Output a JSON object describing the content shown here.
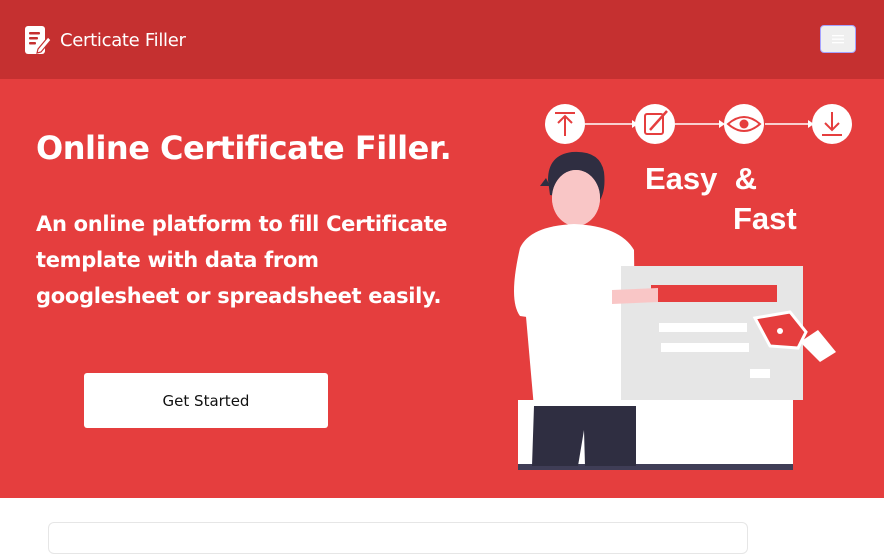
{
  "navbar": {
    "brand_label": "Certicate Filler",
    "brand_icon": "document-pen-icon",
    "toggler_icon": "hamburger-menu-icon"
  },
  "hero": {
    "title": "Online Certificate Filler.",
    "subtitle": "An online platform to fill Certificate template with data from googlesheet or spreadsheet easily.",
    "cta_label": "Get Started"
  },
  "illustration": {
    "steps": [
      "upload-icon",
      "edit-icon",
      "eye-icon",
      "download-icon"
    ],
    "caption_line1": "Easy  &",
    "caption_line2": "Fast"
  },
  "colors": {
    "navbar": "#c53030",
    "hero": "#e53e3e",
    "button_bg": "#ffffff"
  }
}
